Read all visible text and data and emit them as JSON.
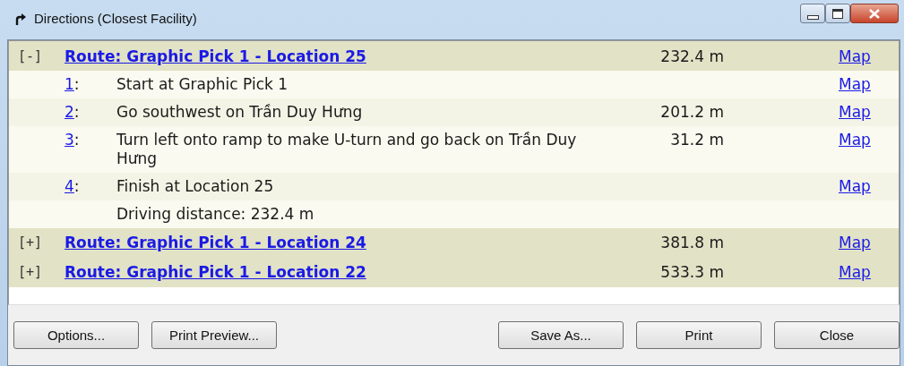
{
  "window": {
    "title": "Directions (Closest Facility)"
  },
  "routes": [
    {
      "toggle": "[-]",
      "name": "Route: Graphic Pick 1 - Location 25",
      "distance": "232.4 m",
      "map": "Map",
      "steps": [
        {
          "number": "1",
          "sep": ":",
          "text": "Start at Graphic Pick 1",
          "map": "Map"
        },
        {
          "number": "2",
          "sep": ":",
          "text": "Go southwest on Trần Duy Hưng",
          "distance": "201.2 m",
          "map": "Map"
        },
        {
          "number": "3",
          "sep": ":",
          "text": "Turn left onto ramp to make U-turn and go back on Trần Duy Hưng",
          "distance": "31.2 m",
          "map": "Map"
        },
        {
          "number": "4",
          "sep": ":",
          "text": "Finish at Location 25",
          "map": "Map"
        },
        {
          "text": "Driving distance: 232.4 m"
        }
      ]
    },
    {
      "toggle": "[+]",
      "name": "Route: Graphic Pick 1 - Location 24",
      "distance": "381.8 m",
      "map": "Map"
    },
    {
      "toggle": "[+]",
      "name": "Route: Graphic Pick 1 - Location 22",
      "distance": "533.3 m",
      "map": "Map"
    }
  ],
  "buttons_left": [
    "Options...",
    "Print Preview..."
  ],
  "buttons_right": [
    "Save As...",
    "Print",
    "Close"
  ]
}
